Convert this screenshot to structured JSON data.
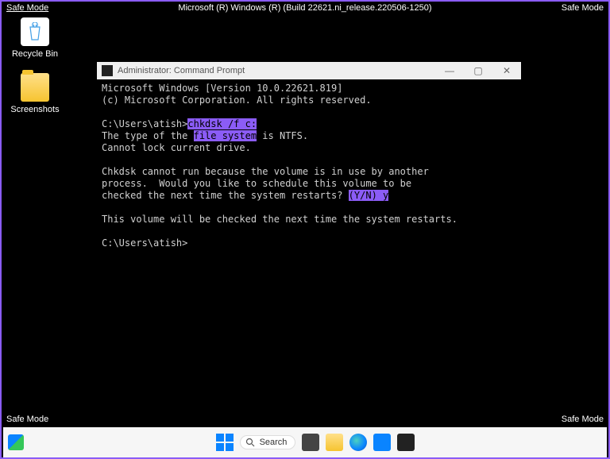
{
  "corners": {
    "top_left": "Safe Mode",
    "top_center": "Microsoft (R) Windows (R) (Build 22621.ni_release.220506-1250)",
    "top_right": "Safe Mode",
    "bottom_left": "Safe Mode",
    "bottom_right": "Safe Mode"
  },
  "desktop": {
    "recycle_bin": "Recycle Bin",
    "screenshots": "Screenshots"
  },
  "cmd": {
    "title": "Administrator: Command Prompt",
    "ver1": "Microsoft Windows [Version 10.0.22621.819]",
    "ver2": "(c) Microsoft Corporation. All rights reserved.",
    "prompt1": "C:\\Users\\atish>",
    "command": "chkdsk /f c:",
    "line_fs1": "The type of the ",
    "line_fs_hl": "file system",
    "line_fs2": " is NTFS.",
    "line_lock": "Cannot lock current drive.",
    "line_busy1": "Chkdsk cannot run because the volume is in use by another",
    "line_busy2": "process.  Would you like to schedule this volume to be",
    "line_busy3a": "checked the next time the system restarts? ",
    "line_busy3_hl": "(Y/N) y",
    "line_sched": "This volume will be checked the next time the system restarts.",
    "prompt2": "C:\\Users\\atish>"
  },
  "taskbar": {
    "search_placeholder": "Search"
  }
}
